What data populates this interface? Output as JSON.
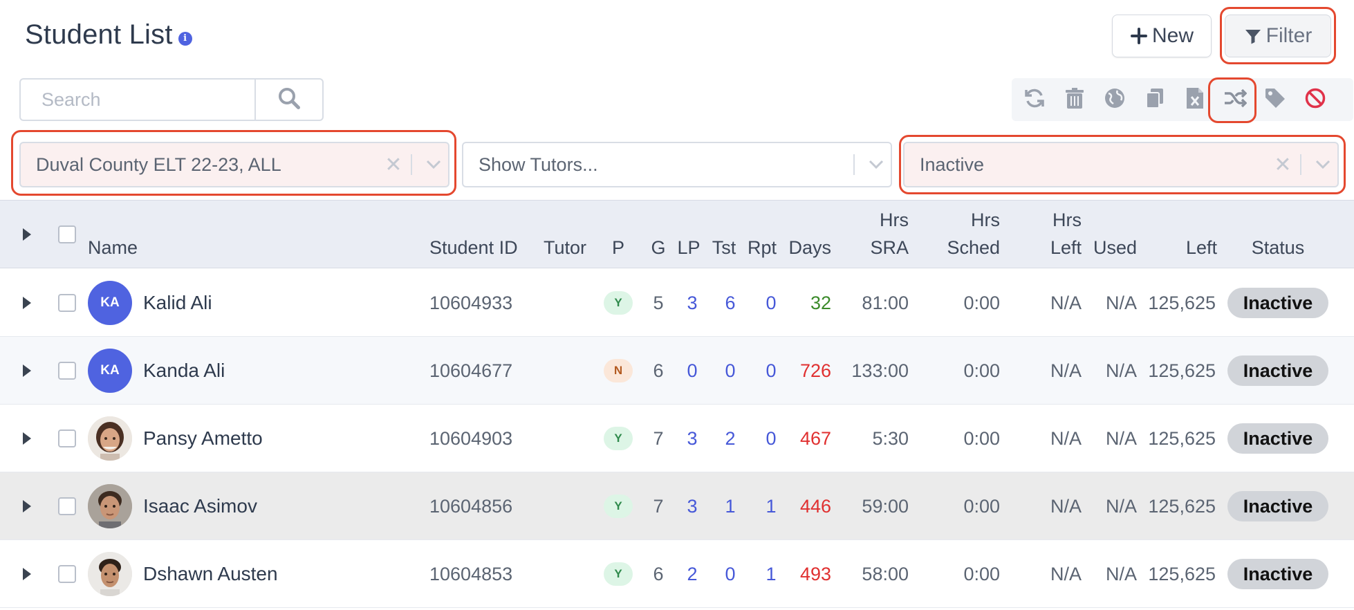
{
  "header": {
    "title": "Student List",
    "info_icon": "info-icon",
    "new_label": "New",
    "filter_label": "Filter"
  },
  "search": {
    "placeholder": "Search"
  },
  "toolbar": {
    "icons": [
      "refresh-icon",
      "trash-icon",
      "globe-icon",
      "copy-icon",
      "excel-icon",
      "shuffle-icon",
      "tag-icon",
      "block-icon"
    ]
  },
  "filters": {
    "county": "Duval County ELT 22-23, ALL",
    "tutors_placeholder": "Show Tutors...",
    "status": "Inactive"
  },
  "table": {
    "headers": {
      "name": "Name",
      "student_id": "Student ID",
      "tutor": "Tutor",
      "p": "P",
      "g": "G",
      "lp": "LP",
      "tst": "Tst",
      "rpt": "Rpt",
      "days": "Days",
      "hrs_sra_1": "Hrs",
      "hrs_sra_2": "SRA",
      "hrs_sched_1": "Hrs",
      "hrs_sched_2": "Sched",
      "hrs_left_1": "Hrs",
      "hrs_left_2": "Left",
      "used": "Used",
      "left": "Left",
      "status": "Status"
    },
    "rows": [
      {
        "initials": "KA",
        "name": "Kalid Ali",
        "student_id": "10604933",
        "tutor": "",
        "p": "Y",
        "g": "5",
        "lp": "3",
        "tst": "6",
        "rpt": "0",
        "days": "32",
        "hrs_sra": "81:00",
        "hrs_sched": "0:00",
        "hrs_left": "N/A",
        "used": "N/A",
        "left": "125,625",
        "status": "Inactive"
      },
      {
        "initials": "KA",
        "name": "Kanda Ali",
        "student_id": "10604677",
        "tutor": "",
        "p": "N",
        "g": "6",
        "lp": "0",
        "tst": "0",
        "rpt": "0",
        "days": "726",
        "hrs_sra": "133:00",
        "hrs_sched": "0:00",
        "hrs_left": "N/A",
        "used": "N/A",
        "left": "125,625",
        "status": "Inactive"
      },
      {
        "initials": "",
        "name": "Pansy Ametto",
        "student_id": "10604903",
        "tutor": "",
        "p": "Y",
        "g": "7",
        "lp": "3",
        "tst": "2",
        "rpt": "0",
        "days": "467",
        "hrs_sra": "5:30",
        "hrs_sched": "0:00",
        "hrs_left": "N/A",
        "used": "N/A",
        "left": "125,625",
        "status": "Inactive"
      },
      {
        "initials": "",
        "name": "Isaac Asimov",
        "student_id": "10604856",
        "tutor": "",
        "p": "Y",
        "g": "7",
        "lp": "3",
        "tst": "1",
        "rpt": "1",
        "days": "446",
        "hrs_sra": "59:00",
        "hrs_sched": "0:00",
        "hrs_left": "N/A",
        "used": "N/A",
        "left": "125,625",
        "status": "Inactive"
      },
      {
        "initials": "",
        "name": "Dshawn Austen",
        "student_id": "10604853",
        "tutor": "",
        "p": "Y",
        "g": "6",
        "lp": "2",
        "tst": "0",
        "rpt": "1",
        "days": "493",
        "hrs_sra": "58:00",
        "hrs_sched": "0:00",
        "hrs_left": "N/A",
        "used": "N/A",
        "left": "125,625",
        "status": "Inactive"
      }
    ]
  },
  "colors": {
    "accent": "#4f63e0",
    "highlight": "#e4482f",
    "days_green": "#3b8a2a",
    "days_red": "#e03030",
    "link_blue": "#4658d8"
  }
}
